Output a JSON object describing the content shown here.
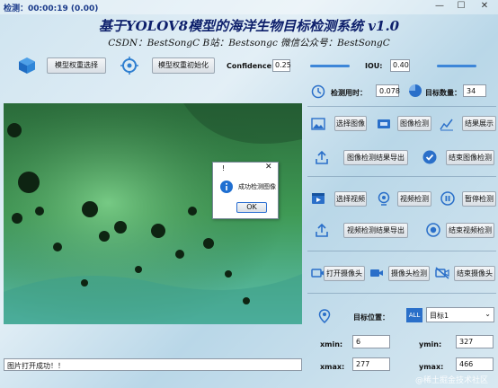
{
  "window": {
    "title": "检测：00:00:19 (0.00)",
    "min": "—",
    "max": "☐",
    "close": "✕"
  },
  "header": {
    "title": "基于YOLOV8模型的海洋生物目标检测系统 v1.0",
    "subtitle": "CSDN：BestSongC   B站：Bestsongc   微信公众号：BestSongC"
  },
  "toolbar": {
    "model_select": "模型权重选择",
    "model_init": "模型权重初始化",
    "confidence_label": "Confidence:",
    "confidence_value": "0.25",
    "iou_label": "IOU:",
    "iou_value": "0.40",
    "confidence_level": 0.25,
    "iou_level": 0.4
  },
  "stats": {
    "time_label": "检测用时：",
    "time_value": "0.078",
    "count_label": "目标数量：",
    "count_value": "34"
  },
  "image_controls": {
    "select_image": "选择图像",
    "image_detect": "图像检测",
    "show_result": "结果展示",
    "export_image": "图像检测结果导出",
    "end_image": "结束图像检测"
  },
  "video_controls": {
    "select_video": "选择视频",
    "video_detect": "视频检测",
    "pause_detect": "暂停检测",
    "export_video": "视频检测结果导出",
    "end_video": "结束视频检测"
  },
  "camera_controls": {
    "open_camera": "打开摄像头",
    "camera_detect": "摄像头检测",
    "close_camera": "结束摄像头"
  },
  "target": {
    "position_label": "目标位置：",
    "all_tag": "ALL",
    "selected": "目标1",
    "xmin_label": "xmin:",
    "xmin": "6",
    "ymin_label": "ymin:",
    "ymin": "327",
    "xmax_label": "xmax:",
    "xmax": "277",
    "ymax_label": "ymax:",
    "ymax": "466"
  },
  "dialog": {
    "title": "!",
    "message": "成功检测图像",
    "ok": "OK"
  },
  "status": {
    "text": "图片打开成功！！"
  },
  "watermark": "@稀土掘金技术社区",
  "colors": {
    "accent": "#3d86d8",
    "title": "#0d1f6b",
    "water": "#2f8a4a"
  }
}
